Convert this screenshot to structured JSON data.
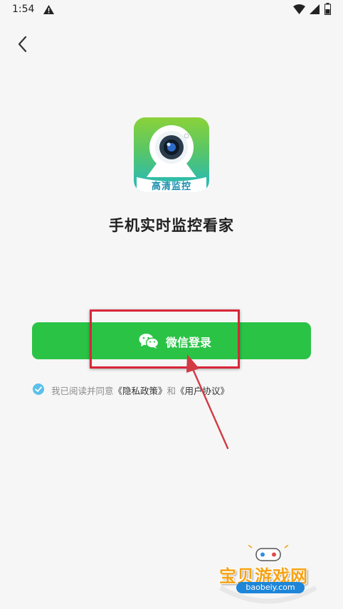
{
  "status_bar": {
    "time": "1:54",
    "icons": [
      "warning-icon",
      "wifi-icon",
      "signal-icon",
      "battery-icon"
    ]
  },
  "nav": {
    "back_icon": "chevron-left-icon"
  },
  "app": {
    "logo_text": "高清监控",
    "title": "手机实时监控看家"
  },
  "login": {
    "wechat_label": "微信登录",
    "button_color": "#2ac346"
  },
  "agreement": {
    "checked": true,
    "prefix": "我已阅读并同意",
    "privacy_link": "《隐私政策》",
    "conjunction": "和",
    "user_link": "《用户协议》"
  },
  "annotation": {
    "highlight_color": "#d7263a"
  },
  "watermark": {
    "title": "宝贝游戏网",
    "url": "baobeiy.com"
  }
}
